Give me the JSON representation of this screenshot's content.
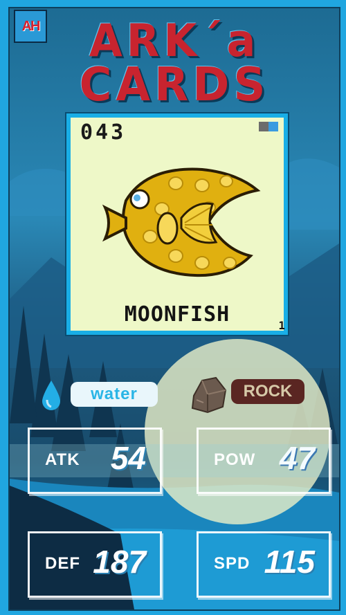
{
  "logo": {
    "text": "AH"
  },
  "title": {
    "line1": "ARK´a",
    "line2": "CARDS"
  },
  "card": {
    "number": "043",
    "name": "MOONFISH",
    "index": "1",
    "colors": {
      "fish_body": "#e0b010",
      "fish_spots": "#f7d85a",
      "fish_outline": "#2a1d05",
      "card_bg": "#eef8c8"
    }
  },
  "types": {
    "primary": {
      "label": "Water",
      "icon": "water-drop-icon",
      "color": "#2ab5e6"
    },
    "secondary": {
      "label": "ROCK",
      "icon": "rock-icon",
      "color": "#5a2622"
    }
  },
  "stats": [
    {
      "key": "atk",
      "label": "ATK",
      "value": "54"
    },
    {
      "key": "pow",
      "label": "POW",
      "value": "47"
    },
    {
      "key": "def",
      "label": "DEF",
      "value": "187"
    },
    {
      "key": "spd",
      "label": "SPD",
      "value": "115"
    }
  ]
}
